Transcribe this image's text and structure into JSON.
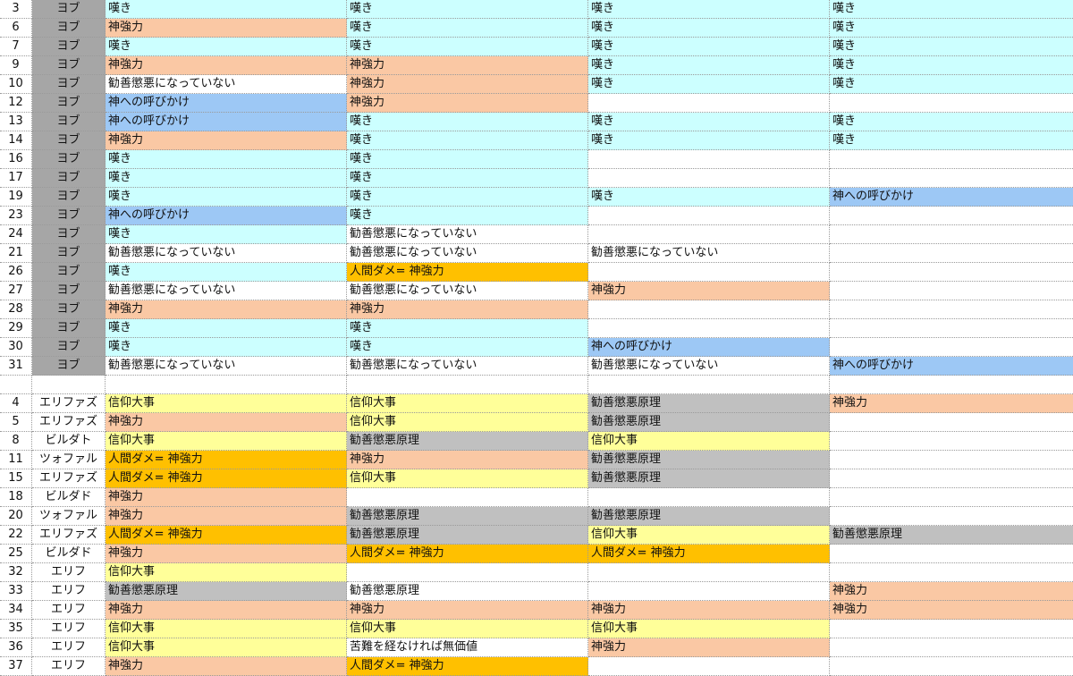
{
  "colors": {
    "nageki": "#ccffff",
    "kami_kyouryoku": "#fac8a4",
    "kami_yobikake": "#9dc8f5",
    "ningen_dame": "#ffc000",
    "shinkou": "#ffff99",
    "kanzen_genri": "#c0c0c0",
    "none": "#ffffff",
    "name_shade": "#a6a6a6"
  },
  "rows": [
    {
      "num": "3",
      "name": "ヨブ",
      "shade": true,
      "cells": [
        [
          "嘆き",
          "nageki"
        ],
        [
          "嘆き",
          "nageki"
        ],
        [
          "嘆き",
          "nageki"
        ],
        [
          "嘆き",
          "nageki"
        ]
      ]
    },
    {
      "num": "6",
      "name": "ヨブ",
      "shade": true,
      "cells": [
        [
          "神強力",
          "kami_kyouryoku"
        ],
        [
          "嘆き",
          "nageki"
        ],
        [
          "嘆き",
          "nageki"
        ],
        [
          "嘆き",
          "nageki"
        ]
      ]
    },
    {
      "num": "7",
      "name": "ヨブ",
      "shade": true,
      "cells": [
        [
          "嘆き",
          "nageki"
        ],
        [
          "嘆き",
          "nageki"
        ],
        [
          "嘆き",
          "nageki"
        ],
        [
          "嘆き",
          "nageki"
        ]
      ]
    },
    {
      "num": "9",
      "name": "ヨブ",
      "shade": true,
      "cells": [
        [
          "神強力",
          "kami_kyouryoku"
        ],
        [
          "神強力",
          "kami_kyouryoku"
        ],
        [
          "嘆き",
          "nageki"
        ],
        [
          "嘆き",
          "nageki"
        ]
      ]
    },
    {
      "num": "10",
      "name": "ヨブ",
      "shade": true,
      "cells": [
        [
          "勧善懲悪になっていない",
          "none"
        ],
        [
          "神強力",
          "kami_kyouryoku"
        ],
        [
          "嘆き",
          "nageki"
        ],
        [
          "嘆き",
          "nageki"
        ]
      ]
    },
    {
      "num": "12",
      "name": "ヨブ",
      "shade": true,
      "cells": [
        [
          "神への呼びかけ",
          "kami_yobikake"
        ],
        [
          "神強力",
          "kami_kyouryoku"
        ],
        [
          "",
          "none"
        ],
        [
          "",
          "none"
        ]
      ]
    },
    {
      "num": "13",
      "name": "ヨブ",
      "shade": true,
      "cells": [
        [
          "神への呼びかけ",
          "kami_yobikake"
        ],
        [
          "嘆き",
          "nageki"
        ],
        [
          "嘆き",
          "nageki"
        ],
        [
          "嘆き",
          "nageki"
        ]
      ]
    },
    {
      "num": "14",
      "name": "ヨブ",
      "shade": true,
      "cells": [
        [
          "神強力",
          "kami_kyouryoku"
        ],
        [
          "嘆き",
          "nageki"
        ],
        [
          "嘆き",
          "nageki"
        ],
        [
          "嘆き",
          "nageki"
        ]
      ]
    },
    {
      "num": "16",
      "name": "ヨブ",
      "shade": true,
      "cells": [
        [
          "嘆き",
          "nageki"
        ],
        [
          "嘆き",
          "nageki"
        ],
        [
          "",
          "none"
        ],
        [
          "",
          "none"
        ]
      ]
    },
    {
      "num": "17",
      "name": "ヨブ",
      "shade": true,
      "cells": [
        [
          "嘆き",
          "nageki"
        ],
        [
          "嘆き",
          "nageki"
        ],
        [
          "",
          "none"
        ],
        [
          "",
          "none"
        ]
      ]
    },
    {
      "num": "19",
      "name": "ヨブ",
      "shade": true,
      "cells": [
        [
          "嘆き",
          "nageki"
        ],
        [
          "嘆き",
          "nageki"
        ],
        [
          "嘆き",
          "nageki"
        ],
        [
          "神への呼びかけ",
          "kami_yobikake"
        ]
      ]
    },
    {
      "num": "23",
      "name": "ヨブ",
      "shade": true,
      "cells": [
        [
          "神への呼びかけ",
          "kami_yobikake"
        ],
        [
          "嘆き",
          "nageki"
        ],
        [
          "",
          "none"
        ],
        [
          "",
          "none"
        ]
      ]
    },
    {
      "num": "24",
      "name": "ヨブ",
      "shade": true,
      "cells": [
        [
          "嘆き",
          "nageki"
        ],
        [
          "勧善懲悪になっていない",
          "none"
        ],
        [
          "",
          "none"
        ],
        [
          "",
          "none"
        ]
      ]
    },
    {
      "num": "21",
      "name": "ヨブ",
      "shade": true,
      "cells": [
        [
          "勧善懲悪になっていない",
          "none"
        ],
        [
          "勧善懲悪になっていない",
          "none"
        ],
        [
          "勧善懲悪になっていない",
          "none"
        ],
        [
          "",
          "none"
        ]
      ]
    },
    {
      "num": "26",
      "name": "ヨブ",
      "shade": true,
      "cells": [
        [
          "嘆き",
          "nageki"
        ],
        [
          "人間ダメ= 神強力",
          "ningen_dame"
        ],
        [
          "",
          "none"
        ],
        [
          "",
          "none"
        ]
      ]
    },
    {
      "num": "27",
      "name": "ヨブ",
      "shade": true,
      "cells": [
        [
          "勧善懲悪になっていない",
          "none"
        ],
        [
          "勧善懲悪になっていない",
          "none"
        ],
        [
          "神強力",
          "kami_kyouryoku"
        ],
        [
          "",
          "none"
        ]
      ]
    },
    {
      "num": "28",
      "name": "ヨブ",
      "shade": true,
      "cells": [
        [
          "神強力",
          "kami_kyouryoku"
        ],
        [
          "神強力",
          "kami_kyouryoku"
        ],
        [
          "",
          "none"
        ],
        [
          "",
          "none"
        ]
      ]
    },
    {
      "num": "29",
      "name": "ヨブ",
      "shade": true,
      "cells": [
        [
          "嘆き",
          "nageki"
        ],
        [
          "嘆き",
          "nageki"
        ],
        [
          "",
          "none"
        ],
        [
          "",
          "none"
        ]
      ]
    },
    {
      "num": "30",
      "name": "ヨブ",
      "shade": true,
      "cells": [
        [
          "嘆き",
          "nageki"
        ],
        [
          "嘆き",
          "nageki"
        ],
        [
          "神への呼びかけ",
          "kami_yobikake"
        ],
        [
          "",
          "none"
        ]
      ]
    },
    {
      "num": "31",
      "name": "ヨブ",
      "shade": true,
      "cells": [
        [
          "勧善懲悪になっていない",
          "none"
        ],
        [
          "勧善懲悪になっていない",
          "none"
        ],
        [
          "勧善懲悪になっていない",
          "none"
        ],
        [
          "神への呼びかけ",
          "kami_yobikake"
        ]
      ]
    },
    {
      "num": "",
      "name": "",
      "shade": false,
      "cells": [
        [
          "",
          "none"
        ],
        [
          "",
          "none"
        ],
        [
          "",
          "none"
        ],
        [
          "",
          "none"
        ]
      ]
    },
    {
      "num": "4",
      "name": "エリファズ",
      "shade": false,
      "cells": [
        [
          "信仰大事",
          "shinkou"
        ],
        [
          "信仰大事",
          "shinkou"
        ],
        [
          "勧善懲悪原理",
          "kanzen_genri"
        ],
        [
          "神強力",
          "kami_kyouryoku"
        ]
      ]
    },
    {
      "num": "5",
      "name": "エリファズ",
      "shade": false,
      "cells": [
        [
          "神強力",
          "kami_kyouryoku"
        ],
        [
          "信仰大事",
          "shinkou"
        ],
        [
          "勧善懲悪原理",
          "kanzen_genri"
        ],
        [
          "",
          "none"
        ]
      ]
    },
    {
      "num": "8",
      "name": "ビルダト",
      "shade": false,
      "cells": [
        [
          "信仰大事",
          "shinkou"
        ],
        [
          "勧善懲悪原理",
          "kanzen_genri"
        ],
        [
          "信仰大事",
          "shinkou"
        ],
        [
          "",
          "none"
        ]
      ]
    },
    {
      "num": "11",
      "name": "ツォファル",
      "shade": false,
      "cells": [
        [
          "人間ダメ= 神強力",
          "ningen_dame"
        ],
        [
          "神強力",
          "kami_kyouryoku"
        ],
        [
          "勧善懲悪原理",
          "kanzen_genri"
        ],
        [
          "",
          "none"
        ]
      ]
    },
    {
      "num": "15",
      "name": "エリファズ",
      "shade": false,
      "cells": [
        [
          "人間ダメ= 神強力",
          "ningen_dame"
        ],
        [
          "信仰大事",
          "shinkou"
        ],
        [
          "勧善懲悪原理",
          "kanzen_genri"
        ],
        [
          "",
          "none"
        ]
      ]
    },
    {
      "num": "18",
      "name": "ビルダド",
      "shade": false,
      "cells": [
        [
          "神強力",
          "kami_kyouryoku"
        ],
        [
          "",
          "none"
        ],
        [
          "",
          "none"
        ],
        [
          "",
          "none"
        ]
      ]
    },
    {
      "num": "20",
      "name": "ツォファル",
      "shade": false,
      "cells": [
        [
          "神強力",
          "kami_kyouryoku"
        ],
        [
          "勧善懲悪原理",
          "kanzen_genri"
        ],
        [
          "勧善懲悪原理",
          "kanzen_genri"
        ],
        [
          "",
          "none"
        ]
      ]
    },
    {
      "num": "22",
      "name": "エリファズ",
      "shade": false,
      "cells": [
        [
          "人間ダメ= 神強力",
          "ningen_dame"
        ],
        [
          "勧善懲悪原理",
          "kanzen_genri"
        ],
        [
          "信仰大事",
          "shinkou"
        ],
        [
          "勧善懲悪原理",
          "kanzen_genri"
        ]
      ]
    },
    {
      "num": "25",
      "name": "ビルダド",
      "shade": false,
      "cells": [
        [
          "神強力",
          "kami_kyouryoku"
        ],
        [
          "人間ダメ= 神強力",
          "ningen_dame"
        ],
        [
          "人間ダメ= 神強力",
          "ningen_dame"
        ],
        [
          "",
          "none"
        ]
      ]
    },
    {
      "num": "32",
      "name": "エリフ",
      "shade": false,
      "cells": [
        [
          "信仰大事",
          "shinkou"
        ],
        [
          "",
          "none"
        ],
        [
          "",
          "none"
        ],
        [
          "",
          "none"
        ]
      ]
    },
    {
      "num": "33",
      "name": "エリフ",
      "shade": false,
      "cells": [
        [
          "勧善懲悪原理",
          "kanzen_genri"
        ],
        [
          "勧善懲悪原理",
          "none"
        ],
        [
          "",
          "none"
        ],
        [
          "神強力",
          "kami_kyouryoku"
        ]
      ]
    },
    {
      "num": "34",
      "name": "エリフ",
      "shade": false,
      "cells": [
        [
          "神強力",
          "kami_kyouryoku"
        ],
        [
          "神強力",
          "kami_kyouryoku"
        ],
        [
          "神強力",
          "kami_kyouryoku"
        ],
        [
          "神強力",
          "kami_kyouryoku"
        ]
      ]
    },
    {
      "num": "35",
      "name": "エリフ",
      "shade": false,
      "cells": [
        [
          "信仰大事",
          "shinkou"
        ],
        [
          "信仰大事",
          "shinkou"
        ],
        [
          "信仰大事",
          "shinkou"
        ],
        [
          "",
          "none"
        ]
      ]
    },
    {
      "num": "36",
      "name": "エリフ",
      "shade": false,
      "cells": [
        [
          "信仰大事",
          "shinkou"
        ],
        [
          "苦難を経なければ無価値",
          "none"
        ],
        [
          "神強力",
          "kami_kyouryoku"
        ],
        [
          "",
          "none"
        ]
      ]
    },
    {
      "num": "37",
      "name": "エリフ",
      "shade": false,
      "cells": [
        [
          "神強力",
          "kami_kyouryoku"
        ],
        [
          "人間ダメ= 神強力",
          "ningen_dame"
        ],
        [
          "",
          "none"
        ],
        [
          "",
          "none"
        ]
      ]
    }
  ]
}
